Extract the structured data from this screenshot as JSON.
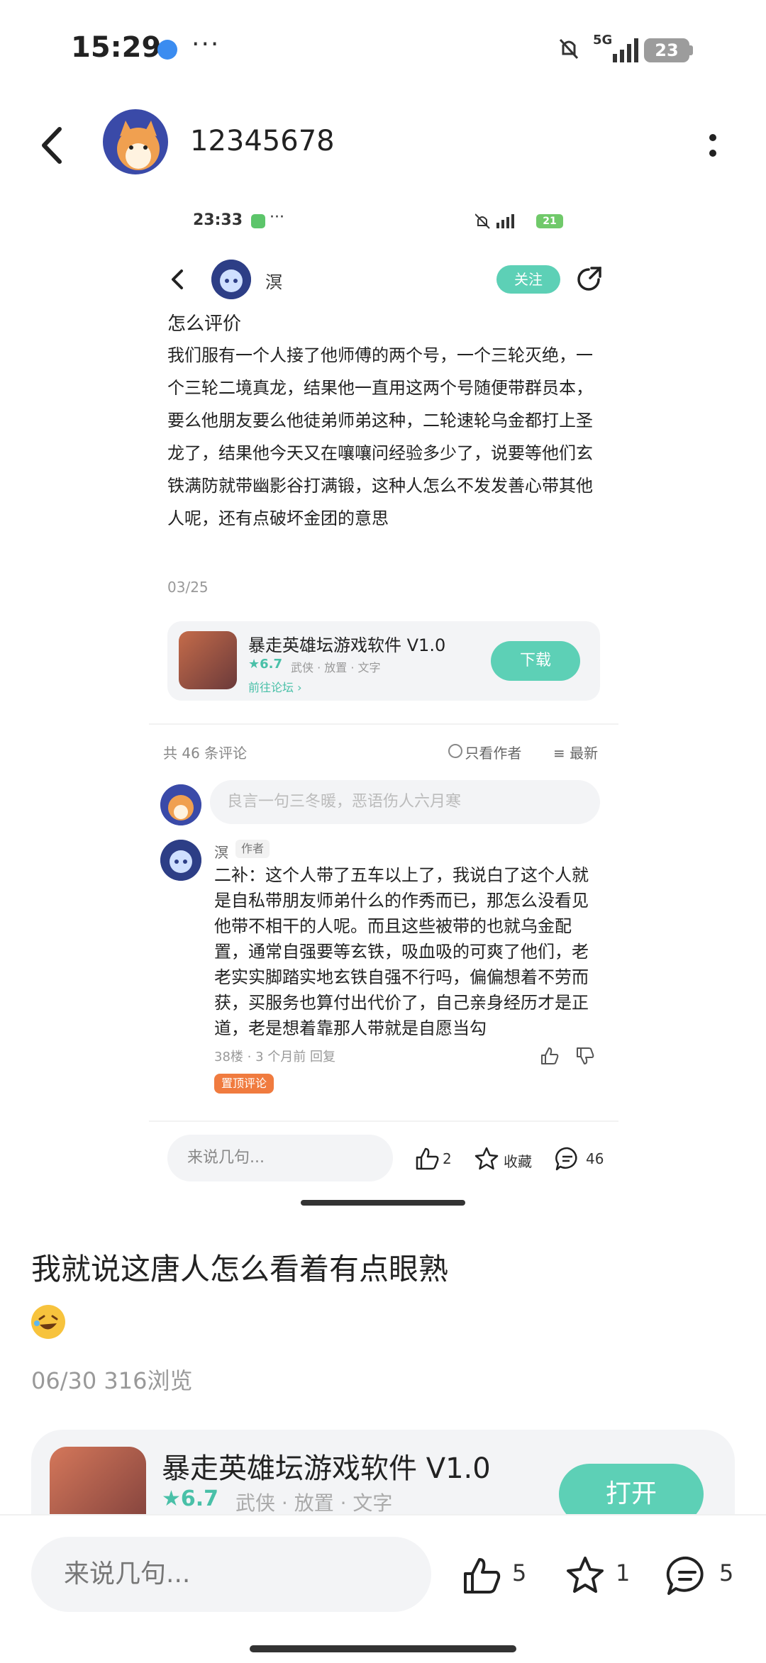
{
  "status_bar": {
    "time": "15:29",
    "network": "5G",
    "battery": "23",
    "more": "···"
  },
  "header": {
    "username": "12345678"
  },
  "embedded": {
    "status_time": "23:33",
    "status_more": "···",
    "status_battery": "21",
    "author": "溟",
    "follow_label": "关注",
    "title": "怎么评价",
    "body": "我们服有一个人接了他师傅的两个号，一个三轮灭绝，一个三轮二境真龙，结果他一直用这两个号随便带群员本，要么他朋友要么他徒弟师弟这种，二轮速轮乌金都打上圣龙了，结果他今天又在嚷嚷问经验多少了，说要等他们玄铁满防就带幽影谷打满锻，这种人怎么不发发善心带其他人呢，还有点破坏金团的意思",
    "date": "03/25",
    "app": {
      "name": "暴走英雄坛游戏软件 V1.0",
      "rating": "★6.7",
      "tags": "武侠 · 放置 · 文字",
      "forum_link": "前往论坛 ›",
      "download_label": "下载"
    },
    "comment_count": "共 46 条评论",
    "filter_author": "只看作者",
    "sort_label": "最新",
    "comment_placeholder": "良言一句三冬暖，恶语伤人六月寒",
    "comment": {
      "author": "溟",
      "badge": "作者",
      "text": "二补：这个人带了五车以上了，我说白了这个人就是自私带朋友师弟什么的作秀而已，那怎么没看见他带不相干的人呢。而且这些被带的也就乌金配置，通常自强要等玄铁，吸血吸的可爽了他们，老老实实脚踏实地玄铁自强不行吗，偏偏想着不劳而获，买服务也算付出代价了，自己亲身经历才是正道，老是想着靠那人带就是自愿当勾",
      "meta": "38楼 · 3 个月前   回复",
      "pinned": "置顶评论"
    },
    "bottom": {
      "input_placeholder": "来说几句...",
      "likes": "2",
      "fav_label": "收藏",
      "comments": "46"
    }
  },
  "post": {
    "title": "我就说这唐人怎么看着有点眼熟",
    "emoji": "rolling-on-floor-laughing",
    "meta": "06/30   316浏览"
  },
  "app_card": {
    "name": "暴走英雄坛游戏软件 V1.0",
    "rating": "★6.7",
    "tags": "武侠 · 放置 · 文字",
    "open_label": "打开"
  },
  "bottom_bar": {
    "input_placeholder": "来说几句...",
    "likes": "5",
    "favorites": "1",
    "comments": "5"
  },
  "colors": {
    "accent": "#5dd0b6",
    "pin": "#f07b3f"
  }
}
